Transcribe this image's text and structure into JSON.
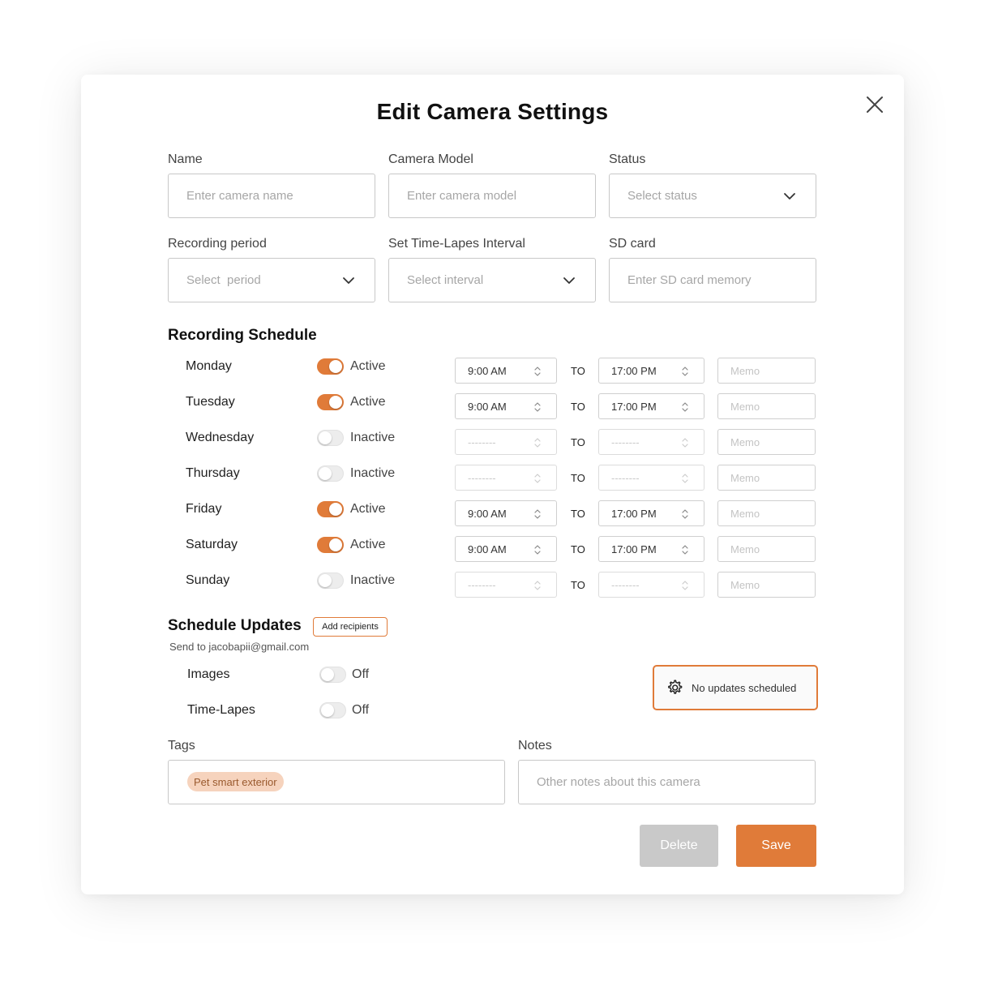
{
  "modal": {
    "title": "Edit Camera Settings"
  },
  "fields": {
    "name": {
      "label": "Name",
      "placeholder": "Enter camera name"
    },
    "camera_model": {
      "label": "Camera Model",
      "placeholder": "Enter camera model"
    },
    "status": {
      "label": "Status",
      "placeholder": "Select status"
    },
    "recording_period": {
      "label": "Recording period",
      "placeholder": "Select  period"
    },
    "time_lapse_interval": {
      "label": "Set Time-Lapes Interval",
      "placeholder": "Select interval"
    },
    "sd_card": {
      "label": "SD card",
      "placeholder": "Enter SD card memory"
    }
  },
  "recording_schedule": {
    "title": "Recording Schedule",
    "to_label": "TO",
    "days": [
      {
        "day": "Monday",
        "active": true,
        "status": "Active",
        "from": "9:00 AM",
        "to": "17:00 PM",
        "memo": "Memo"
      },
      {
        "day": "Tuesday",
        "active": true,
        "status": "Active",
        "from": "9:00 AM",
        "to": "17:00 PM",
        "memo": "Memo"
      },
      {
        "day": "Wednesday",
        "active": false,
        "status": "Inactive",
        "from": "--------",
        "to": "--------",
        "memo": "Memo"
      },
      {
        "day": "Thursday",
        "active": false,
        "status": "Inactive",
        "from": "--------",
        "to": "--------",
        "memo": "Memo"
      },
      {
        "day": "Friday",
        "active": true,
        "status": "Active",
        "from": "9:00 AM",
        "to": "17:00 PM",
        "memo": "Memo"
      },
      {
        "day": "Saturday",
        "active": true,
        "status": "Active",
        "from": "9:00 AM",
        "to": "17:00 PM",
        "memo": "Memo"
      },
      {
        "day": "Sunday",
        "active": false,
        "status": "Inactive",
        "from": "--------",
        "to": "--------",
        "memo": "Memo"
      }
    ]
  },
  "schedule_updates": {
    "title": "Schedule Updates",
    "add_recipients": "Add recipients",
    "send_to": "Send to jacobapii@gmail.com",
    "images": {
      "label": "Images",
      "status": "Off",
      "on": false
    },
    "time_lapse": {
      "label": "Time-Lapes",
      "status": "Off",
      "on": false
    },
    "no_updates": "No updates scheduled"
  },
  "tags": {
    "label": "Tags",
    "items": [
      "Pet smart exterior"
    ]
  },
  "notes": {
    "label": "Notes",
    "placeholder": "Other notes about this camera"
  },
  "actions": {
    "delete": "Delete",
    "save": "Save"
  },
  "colors": {
    "accent": "#e07b39",
    "tag_bg": "#f6d3bd",
    "disabled_button": "#c9c9c9"
  },
  "icons": {
    "close": "close-icon",
    "chevron": "chevron-down-icon",
    "spinner": "up-down-arrows-icon",
    "gear": "gear-icon"
  }
}
